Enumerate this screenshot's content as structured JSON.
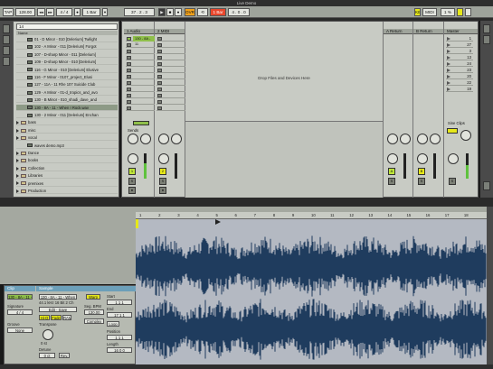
{
  "window": {
    "title": "Live Demo"
  },
  "transport": {
    "tap": "TAP",
    "tempo": "128.00",
    "meter_num": "4 / 4",
    "quant": "1 Bar",
    "follow": "",
    "position": "37 . 2 . 3",
    "key_label": "KEY",
    "midi_label": "MIDI",
    "cpu": "1 %",
    "link_label": ""
  },
  "browser": {
    "search_value": "14",
    "header": "Name",
    "files": [
      {
        "label": "01 - D Minor - 010 [Delerium] Twilight",
        "kind": "file",
        "selected": false
      },
      {
        "label": "102 - A Minor - 011 [Delerium] Forgot",
        "kind": "file",
        "selected": false
      },
      {
        "label": "107 - D-sharp Minor - 011 [Delerium]",
        "kind": "file",
        "selected": false
      },
      {
        "label": "109 - D-sharp Minor - 010 [Delerium]",
        "kind": "file",
        "selected": false
      },
      {
        "label": "116 - G Minor - 010 [Delerium] Elusive",
        "kind": "file",
        "selected": false
      },
      {
        "label": "116 - F Minor - 0107_project_Elusi",
        "kind": "file",
        "selected": false
      },
      {
        "label": "127 - 11A - 11 Rhe 107 Suicide Club",
        "kind": "file",
        "selected": false
      },
      {
        "label": "129 - A Minor - 01-d_tropics_and_avo",
        "kind": "file",
        "selected": false
      },
      {
        "label": "130 - B Minor - 010_shadi_dave_and",
        "kind": "file",
        "selected": false
      },
      {
        "label": "130 - 8A - 11 - When I Rock.wav",
        "kind": "file",
        "selected": true
      },
      {
        "label": "130 - 2 Minor - 011 [Delerium] Enchan",
        "kind": "file",
        "selected": false
      },
      {
        "label": "bass",
        "kind": "folder",
        "selected": false
      },
      {
        "label": "misc",
        "kind": "folder",
        "selected": false
      },
      {
        "label": "vocal",
        "kind": "folder",
        "selected": false
      },
      {
        "label": "waves demo.mp3",
        "kind": "file",
        "selected": false
      },
      {
        "label": "Dance",
        "kind": "folder",
        "selected": false
      },
      {
        "label": "books",
        "kind": "folder",
        "selected": false
      },
      {
        "label": "Collection",
        "kind": "folder",
        "selected": false
      },
      {
        "label": "Libraries",
        "kind": "folder",
        "selected": false
      },
      {
        "label": "premixes",
        "kind": "folder",
        "selected": false
      },
      {
        "label": "Production",
        "kind": "folder",
        "selected": false
      }
    ]
  },
  "session": {
    "tracks": [
      {
        "name": "1 Audio",
        "clip": "130 - 8A - 11",
        "number": "1",
        "num_color": "#bfe63a",
        "clip_color": "#8fbf4a"
      },
      {
        "name": "2 MIDI",
        "clip": "",
        "number": "2",
        "num_color": "#e6e81a",
        "clip_color": ""
      }
    ],
    "drop_hint": "Drop Files and Devices Here",
    "returns": [
      {
        "name": "A Return",
        "letter": "A",
        "color": "#bfe63a"
      },
      {
        "name": "B Return",
        "letter": "B",
        "color": "#e6e81a"
      }
    ],
    "master": {
      "name": "Master",
      "scenes": [
        "1",
        "27",
        "3",
        "13",
        "24",
        "23",
        "20",
        "22",
        "19"
      ]
    },
    "sends_label": "Sends",
    "cue_label": "Cue",
    "solo_label": "Solo"
  },
  "arrangement": {
    "ruler_ticks": [
      "1",
      "2",
      "3",
      "4",
      "5",
      "6",
      "7",
      "8",
      "9",
      "10",
      "11",
      "12",
      "13",
      "14",
      "15",
      "16",
      "17",
      "18"
    ]
  },
  "clip_view": {
    "clip_tab": "Clip",
    "sample_tab": "Sample",
    "clip_name": "130 - 8A - 11 - When",
    "sample_name": "130 - 8A - 11 - When",
    "sample_info": "44.1 kHz 16 Bit 2 Ch",
    "signature_label": "Signature",
    "signature_value": "4 / 4",
    "groove_label": "Groove",
    "groove_value": "None",
    "warp_label": "Warp",
    "seg_bpm_label": "Seg. BPM",
    "seg_bpm_value": "130.00",
    "start_label": "Start",
    "start_value": "1 1 1",
    "end_label": "End",
    "end_value": "17 1 1",
    "loop_label": "Loop",
    "position_label": "Position",
    "length_label": "Length",
    "transpose_label": "Transpose",
    "transpose_value": "0 st",
    "detune_label": "Detune",
    "detune_value": "0 ct",
    "hi_q": "Hi-Q",
    "fade": "Fade",
    "ram": "RAM",
    "rev": "Rev.",
    "complex": "Complex"
  }
}
